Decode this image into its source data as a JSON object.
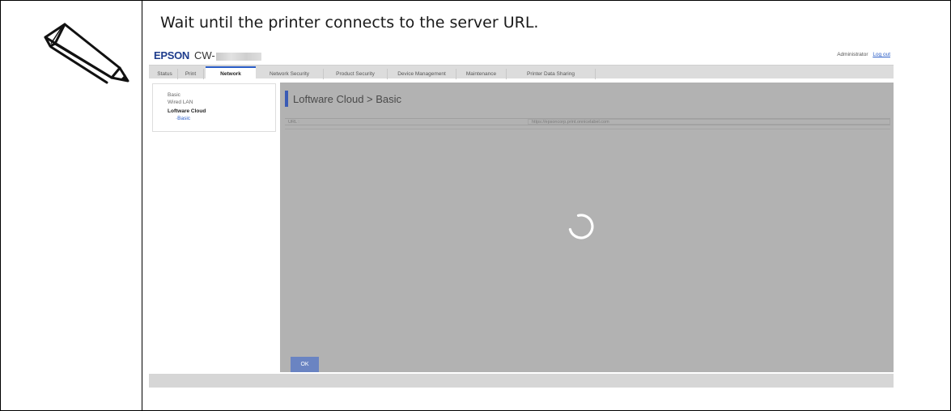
{
  "instruction": "Wait until the printer connects to the server URL.",
  "note_icon": "pencil-note-icon",
  "ui": {
    "brand": "EPSON",
    "model": "CW-",
    "user": {
      "role": "Administrator",
      "logout_label": "Log out"
    },
    "tabs": [
      {
        "label": "Status",
        "active": false
      },
      {
        "label": "Print",
        "active": false
      },
      {
        "label": "Network",
        "active": true
      },
      {
        "label": "Network Security",
        "active": false
      },
      {
        "label": "Product Security",
        "active": false
      },
      {
        "label": "Device Management",
        "active": false
      },
      {
        "label": "Maintenance",
        "active": false
      },
      {
        "label": "Printer Data Sharing",
        "active": false
      }
    ],
    "sidebar": {
      "items": [
        {
          "label": "Basic"
        },
        {
          "label": "Wired LAN"
        },
        {
          "label": "Loftware Cloud"
        },
        {
          "label": "·Basic"
        }
      ]
    },
    "main": {
      "title": "Loftware Cloud > Basic",
      "url_label": "URL :",
      "url_value": "https://epsoncorp.print.onnicelabel.com"
    },
    "ok_label": "OK",
    "spinner_icon": "loading-spinner-icon",
    "colors": {
      "brand": "#1e3c8c",
      "accent": "#2a5dc7",
      "overlay": "#b2b2b2",
      "ok_button": "#6a84c2"
    }
  }
}
